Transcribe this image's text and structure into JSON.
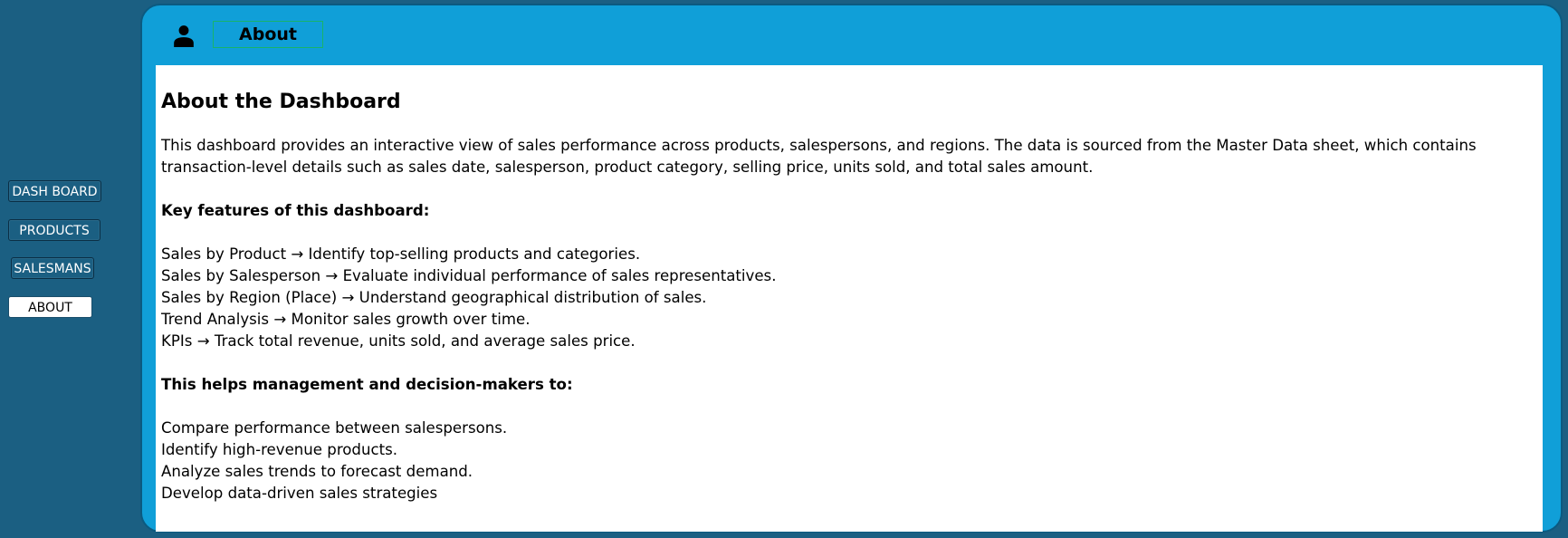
{
  "sidebar": {
    "items": [
      {
        "label": "DASH BOARD"
      },
      {
        "label": "PRODUCTS"
      },
      {
        "label": "SALESMANS"
      },
      {
        "label": "ABOUT"
      }
    ]
  },
  "header": {
    "title": "About",
    "icon": "user-icon"
  },
  "content": {
    "heading": "About the Dashboard",
    "intro": "This dashboard provides an interactive view of sales performance across products, salespersons, and regions. The data is sourced from the Master Data sheet, which contains transaction-level details such as sales date, salesperson, product category, selling price, units sold, and total sales amount.",
    "features_heading": "Key features of this dashboard:",
    "features": [
      "Sales by Product → Identify top-selling products and categories.",
      "Sales by Salesperson → Evaluate individual performance of sales representatives.",
      "Sales by Region (Place) → Understand geographical distribution of sales.",
      "Trend Analysis → Monitor sales growth over time.",
      "KPIs → Track total revenue, units sold, and average sales price."
    ],
    "helps_heading": "This helps management and decision-makers to:",
    "helps": [
      "Compare performance between salespersons.",
      "Identify high-revenue products.",
      "Analyze sales trends to forecast demand.",
      "Develop data-driven sales strategies"
    ]
  },
  "colors": {
    "background": "#1b5f82",
    "panel": "#109fd8",
    "active_button": "#ffffff",
    "title_border": "#19b36a"
  }
}
